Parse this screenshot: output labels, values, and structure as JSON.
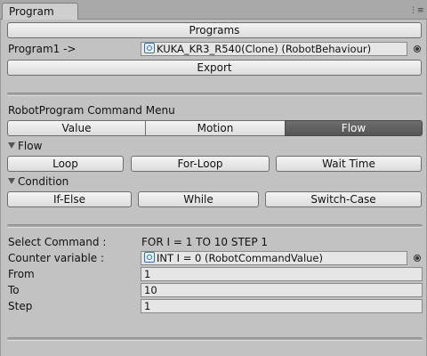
{
  "tab": {
    "title": "Program",
    "menu_icon": "panel-menu-icon"
  },
  "program_section": {
    "programs_button": "Programs",
    "program_label": "Program1 ->",
    "program_value": "KUKA_KR3_R540(Clone) (RobotBehaviour)",
    "export_button": "Export"
  },
  "command_menu": {
    "title": "RobotProgram Command Menu",
    "tabs": [
      {
        "label": "Value",
        "selected": false
      },
      {
        "label": "Motion",
        "selected": false
      },
      {
        "label": "Flow",
        "selected": true
      }
    ],
    "flow_foldout": "Flow",
    "flow_buttons": [
      "Loop",
      "For-Loop",
      "Wait Time"
    ],
    "condition_foldout": "Condition",
    "condition_buttons": [
      "If-Else",
      "While",
      "Switch-Case"
    ]
  },
  "selected_command": {
    "label": "Select Command :",
    "value": "FOR I = 1 TO 10 STEP 1",
    "counter_label": "Counter variable :",
    "counter_value": "INT I = 0 (RobotCommandValue)",
    "from_label": "From",
    "from_value": "1",
    "to_label": "To",
    "to_value": "10",
    "step_label": "Step",
    "step_value": "1"
  },
  "colors": {
    "background": "#c2c2c2",
    "selected_tab": "#5f5f5f",
    "field_bg": "#e6e6e6"
  }
}
